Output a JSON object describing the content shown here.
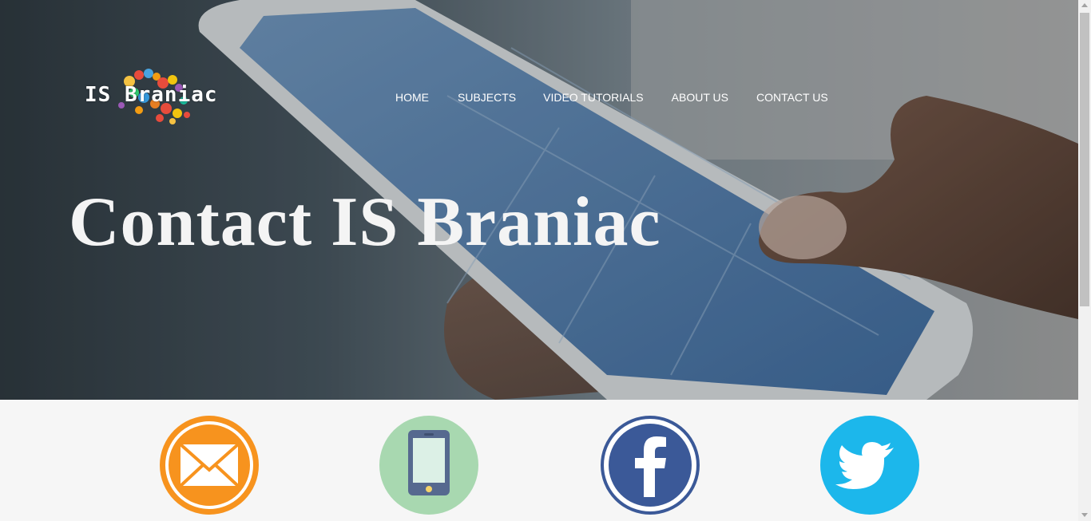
{
  "brand": {
    "logo_text": "IS Braniac"
  },
  "nav": {
    "items": [
      {
        "label": "HOME"
      },
      {
        "label": "SUBJECTS"
      },
      {
        "label": "VIDEO TUTORIALS"
      },
      {
        "label": "ABOUT US"
      },
      {
        "label": "CONTACT US"
      }
    ]
  },
  "hero": {
    "title": "Contact IS Braniac"
  },
  "contact_icons": [
    {
      "name": "email-icon",
      "color": "#f7931e"
    },
    {
      "name": "phone-icon",
      "color": "#a8d8b0"
    },
    {
      "name": "facebook-icon",
      "color": "#3b5998"
    },
    {
      "name": "twitter-icon",
      "color": "#1cb7eb"
    }
  ]
}
